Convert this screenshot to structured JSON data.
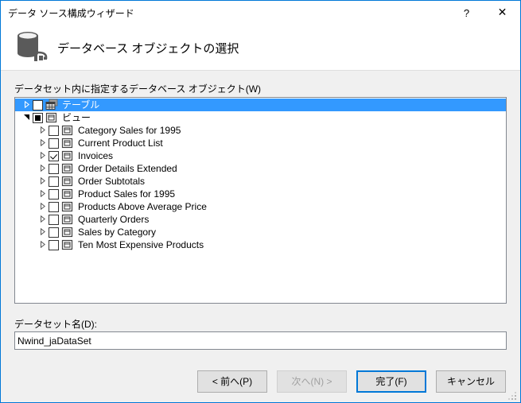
{
  "window": {
    "title": "データ ソース構成ウィザード",
    "accent_color": "#0078d7",
    "body_color": "#f0f0f0",
    "selection_color": "#3399ff"
  },
  "titlebar": {
    "help_glyph": "?",
    "close_glyph": "✕"
  },
  "banner": {
    "title": "データベース オブジェクトの選択",
    "icon": "database-icon"
  },
  "tree": {
    "label": "データセット内に指定するデータベース オブジェクト(W)",
    "nodes": [
      {
        "label": "テーブル",
        "level": 1,
        "expander": "collapsed",
        "checkbox": "unchecked",
        "icon": "table-icon",
        "selected": true
      },
      {
        "label": "ビュー",
        "level": 1,
        "expander": "expanded",
        "checkbox": "indeterminate",
        "icon": "view-icon",
        "selected": false
      },
      {
        "label": "Category Sales for 1995",
        "level": 2,
        "expander": "collapsed",
        "checkbox": "unchecked",
        "icon": "view-icon",
        "selected": false
      },
      {
        "label": "Current Product List",
        "level": 2,
        "expander": "collapsed",
        "checkbox": "unchecked",
        "icon": "view-icon",
        "selected": false
      },
      {
        "label": "Invoices",
        "level": 2,
        "expander": "collapsed",
        "checkbox": "checked",
        "icon": "view-icon",
        "selected": false
      },
      {
        "label": "Order Details Extended",
        "level": 2,
        "expander": "collapsed",
        "checkbox": "unchecked",
        "icon": "view-icon",
        "selected": false
      },
      {
        "label": "Order Subtotals",
        "level": 2,
        "expander": "collapsed",
        "checkbox": "unchecked",
        "icon": "view-icon",
        "selected": false
      },
      {
        "label": "Product Sales for 1995",
        "level": 2,
        "expander": "collapsed",
        "checkbox": "unchecked",
        "icon": "view-icon",
        "selected": false
      },
      {
        "label": "Products Above Average Price",
        "level": 2,
        "expander": "collapsed",
        "checkbox": "unchecked",
        "icon": "view-icon",
        "selected": false
      },
      {
        "label": "Quarterly Orders",
        "level": 2,
        "expander": "collapsed",
        "checkbox": "unchecked",
        "icon": "view-icon",
        "selected": false
      },
      {
        "label": "Sales by Category",
        "level": 2,
        "expander": "collapsed",
        "checkbox": "unchecked",
        "icon": "view-icon",
        "selected": false
      },
      {
        "label": "Ten Most Expensive Products",
        "level": 2,
        "expander": "collapsed",
        "checkbox": "unchecked",
        "icon": "view-icon",
        "selected": false
      }
    ]
  },
  "dataset": {
    "label": "データセット名(D):",
    "value": "Nwind_jaDataSet",
    "placeholder": ""
  },
  "buttons": {
    "previous": "< 前へ(P)",
    "next": "次へ(N) >",
    "finish": "完了(F)",
    "cancel": "キャンセル"
  }
}
